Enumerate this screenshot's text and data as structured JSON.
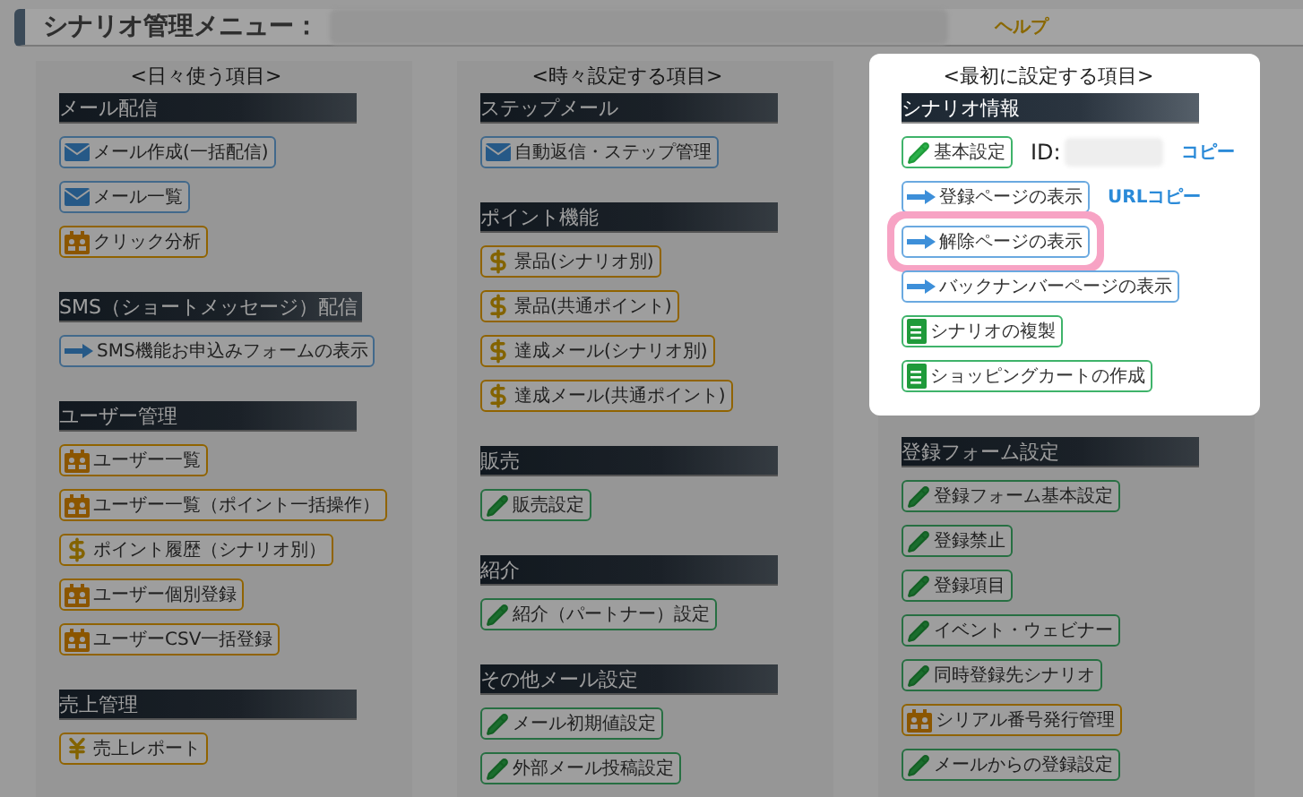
{
  "header": {
    "title": "シナリオ管理メニュー：",
    "help_link": "ヘルプ"
  },
  "columns": [
    {
      "title": "<日々使う項目>",
      "sections": [
        {
          "heading": "メール配信",
          "spotlight": false,
          "items": [
            {
              "kind": "mail",
              "label": "メール作成(一括配信)",
              "circled": false
            },
            {
              "kind": "mail",
              "label": "メール一覧",
              "circled": false
            },
            {
              "kind": "user",
              "label": "クリック分析",
              "circled": false
            }
          ]
        },
        {
          "heading": "SMS（ショートメッセージ）配信",
          "spotlight": false,
          "items": [
            {
              "kind": "arrow",
              "label": "SMS機能お申込みフォームの表示",
              "circled": false
            }
          ]
        },
        {
          "heading": "ユーザー管理",
          "spotlight": false,
          "items": [
            {
              "kind": "user",
              "label": "ユーザー一覧",
              "circled": false
            },
            {
              "kind": "user",
              "label": "ユーザー一覧（ポイント一括操作）",
              "circled": false
            },
            {
              "kind": "dollar",
              "label": "ポイント履歴（シナリオ別）",
              "circled": false
            },
            {
              "kind": "user",
              "label": "ユーザー個別登録",
              "circled": false
            },
            {
              "kind": "user",
              "label": "ユーザーCSV一括登録",
              "circled": false
            }
          ]
        },
        {
          "heading": "売上管理",
          "spotlight": false,
          "items": [
            {
              "kind": "yen",
              "label": "売上レポート",
              "circled": false
            }
          ]
        }
      ]
    },
    {
      "title": "<時々設定する項目>",
      "sections": [
        {
          "heading": "ステップメール",
          "spotlight": false,
          "items": [
            {
              "kind": "mail",
              "label": "自動返信・ステップ管理",
              "circled": false
            }
          ]
        },
        {
          "heading": "ポイント機能",
          "spotlight": false,
          "items": [
            {
              "kind": "dollar",
              "label": "景品(シナリオ別)",
              "circled": false
            },
            {
              "kind": "dollar",
              "label": "景品(共通ポイント)",
              "circled": false
            },
            {
              "kind": "dollar",
              "label": "達成メール(シナリオ別)",
              "circled": false
            },
            {
              "kind": "dollar",
              "label": "達成メール(共通ポイント)",
              "circled": false
            }
          ]
        },
        {
          "heading": "販売",
          "spotlight": false,
          "items": [
            {
              "kind": "pencil",
              "label": "販売設定",
              "circled": false
            }
          ]
        },
        {
          "heading": "紹介",
          "spotlight": false,
          "items": [
            {
              "kind": "pencil",
              "label": "紹介（パートナー）設定",
              "circled": false
            }
          ]
        },
        {
          "heading": "その他メール設定",
          "spotlight": false,
          "items": [
            {
              "kind": "pencil",
              "label": "メール初期値設定",
              "circled": false
            },
            {
              "kind": "pencil",
              "label": "外部メール投稿設定",
              "circled": false
            }
          ]
        }
      ]
    },
    {
      "title": "<最初に設定する項目>",
      "sections": [
        {
          "heading": "シナリオ情報",
          "spotlight": true,
          "items": [
            {
              "kind": "pencil",
              "label": "基本設定",
              "circled": false,
              "id_label": "ID:",
              "link": "コピー"
            },
            {
              "kind": "arrow",
              "label": "登録ページの表示",
              "circled": false,
              "link": "URLコピー"
            },
            {
              "kind": "arrow",
              "label": "解除ページの表示",
              "circled": true
            },
            {
              "kind": "arrow",
              "label": "バックナンバーページの表示",
              "circled": false
            },
            {
              "kind": "doc",
              "label": "シナリオの複製",
              "circled": false
            },
            {
              "kind": "doc",
              "label": "ショッピングカートの作成",
              "circled": false
            }
          ]
        },
        {
          "heading": "登録フォーム設定",
          "spotlight": false,
          "items": [
            {
              "kind": "pencil",
              "label": "登録フォーム基本設定",
              "circled": false
            },
            {
              "kind": "pencil",
              "label": "登録禁止",
              "circled": false
            },
            {
              "kind": "pencil",
              "label": "登録項目",
              "circled": false
            },
            {
              "kind": "pencil",
              "label": "イベント・ウェビナー",
              "circled": false
            },
            {
              "kind": "pencil",
              "label": "同時登録先シナリオ",
              "circled": false
            },
            {
              "kind": "user",
              "label": "シリアル番号発行管理",
              "circled": false
            },
            {
              "kind": "pencil",
              "label": "メールからの登録設定",
              "circled": false
            }
          ]
        }
      ]
    }
  ]
}
